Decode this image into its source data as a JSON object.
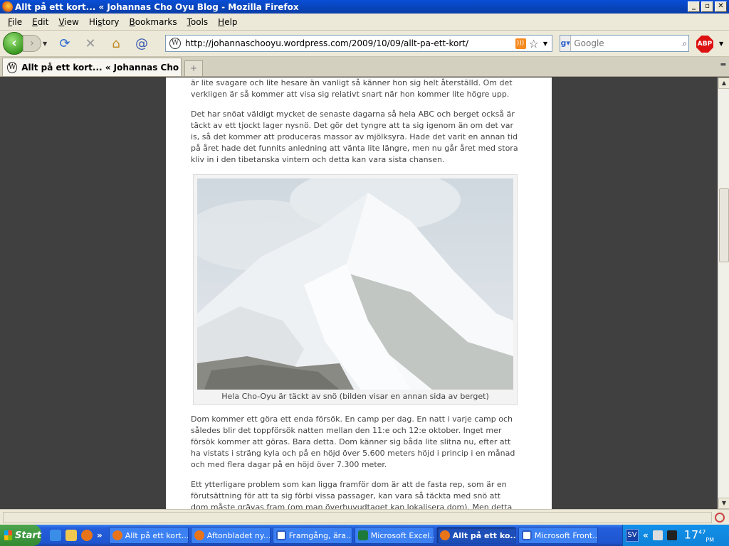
{
  "window": {
    "title": "Allt på ett kort... « Johannas Cho Oyu Blog - Mozilla Firefox",
    "buttons": [
      "_",
      "▫",
      "✕"
    ]
  },
  "menu": [
    {
      "accel": "F",
      "rest": "ile"
    },
    {
      "accel": "E",
      "rest": "dit"
    },
    {
      "accel": "V",
      "rest": "iew"
    },
    {
      "accel": "",
      "rest": "Hi",
      "accel2": "s",
      "rest2": "tory"
    },
    {
      "accel": "B",
      "rest": "ookmarks"
    },
    {
      "accel": "T",
      "rest": "ools"
    },
    {
      "accel": "H",
      "rest": "elp"
    }
  ],
  "nav": {
    "url": "http://johannaschooyu.wordpress.com/2009/10/09/allt-pa-ett-kort/",
    "search_placeholder": "Google",
    "abp": "ABP",
    "rss": ")))"
  },
  "tab": {
    "title": "Allt på ett kort... « Johannas Cho Oy..."
  },
  "post": {
    "paragraphs": [
      "Johanna känner sig helt återställd i lungorna och även om hennes röst fortfarande är lite svagare och lite hesare än vanligt så känner hon sig helt återställd. Om det verkligen är så kommer att visa sig relativt snart när hon kommer lite högre upp.",
      "Det har snöat väldigt mycket de senaste dagarna så hela ABC och berget också är täckt av ett tjockt lager nysnö. Det gör det tyngre att ta sig igenom än om det var is, så det kommer att produceras massor av mjölksyra. Hade det varit en annan tid på året hade det funnits anledning att vänta lite längre, men nu går året med stora kliv in i den tibetanska vintern och detta kan vara sista chansen."
    ],
    "caption": "Hela Cho-Oyu är täckt av snö (bilden visar en annan sida av berget)",
    "paragraphs_after": [
      "Dom kommer ett göra ett enda försök. En camp per dag. En natt i varje camp och således blir det toppförsök natten mellan den 11:e och 12:e oktober. Inget mer försök kommer att göras. Bara detta. Dom känner sig båda lite slitna nu, efter att ha vistats i sträng kyla och på en höjd över 5.600 meters höjd i princip i en månad och med flera dagar på en höjd över 7.300 meter.",
      "Ett ytterligare problem som kan ligga framför dom är att de fasta rep, som är en förutsättning för att ta sig förbi vissa passager, kan vara så täckta med snö att dom måste grävas fram (om man överhuvudtaget kan lokalisera dom). Men detta får dom inga svar på förrän dom är där. Nu gäller det alltså. Allt på ett kort."
    ]
  },
  "taskbar": {
    "start": "Start",
    "tasks": [
      {
        "label": "Allt på ett kort...",
        "icon": "firefox-icon",
        "color": "#e8741a",
        "active": false
      },
      {
        "label": "Aftonbladet ny...",
        "icon": "firefox-icon",
        "color": "#e8741a",
        "active": false
      },
      {
        "label": "Framgång, ära...",
        "icon": "word-icon",
        "color": "#2b5bbf",
        "active": false
      },
      {
        "label": "Microsoft Excel...",
        "icon": "excel-icon",
        "color": "#1d7a3a",
        "active": false
      },
      {
        "label": "Allt på ett ko...",
        "icon": "firefox-icon",
        "color": "#e8741a",
        "active": true
      },
      {
        "label": "Microsoft Front...",
        "icon": "frontpage-icon",
        "color": "#2b5bbf",
        "active": false
      }
    ],
    "lang": "SV",
    "clock_hour": "17",
    "clock_min": "47",
    "clock_ampm": "PM",
    "more": "»",
    "tray_more": "«"
  }
}
